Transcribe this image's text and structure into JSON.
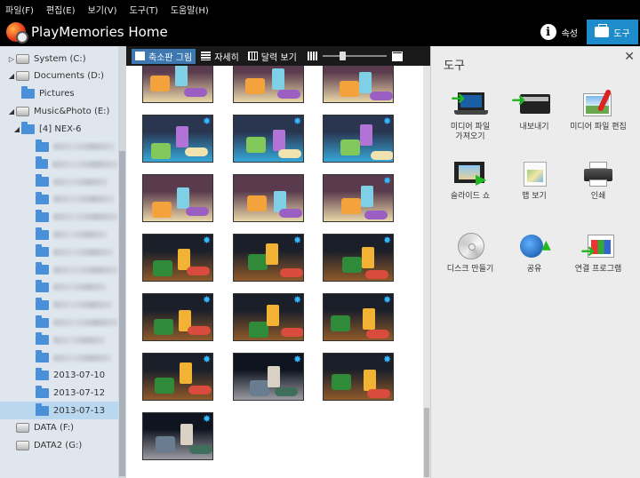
{
  "menu": [
    "파일(F)",
    "편집(E)",
    "보기(V)",
    "도구(T)",
    "도움말(H)"
  ],
  "app_title": "PlayMemories Home",
  "header_buttons": {
    "properties": "속성",
    "tools": "도구"
  },
  "colors": {
    "accent": "#1e8ccb",
    "sidebar_bg": "#dfe6ee",
    "selected_row": "#b9d7ee",
    "folder": "#4a90d9",
    "badge": "#32b8ff"
  },
  "tree": [
    {
      "type": "drive",
      "label": "System (C:)",
      "expanded": false
    },
    {
      "type": "drive",
      "label": "Documents (D:)",
      "expanded": true
    },
    {
      "type": "folder",
      "label": "Pictures"
    },
    {
      "type": "drive",
      "label": "Music&Photo (E:)",
      "expanded": true
    },
    {
      "type": "folder",
      "label": "[4] NEX-6",
      "expanded": true
    },
    {
      "type": "folder",
      "label": "",
      "blurred": true
    },
    {
      "type": "folder",
      "label": "",
      "blurred": true
    },
    {
      "type": "folder",
      "label": "",
      "blurred": true
    },
    {
      "type": "folder",
      "label": "",
      "blurred": true
    },
    {
      "type": "folder",
      "label": "",
      "blurred": true
    },
    {
      "type": "folder",
      "label": "",
      "blurred": true
    },
    {
      "type": "folder",
      "label": "",
      "blurred": true
    },
    {
      "type": "folder",
      "label": "",
      "blurred": true
    },
    {
      "type": "folder",
      "label": "",
      "blurred": true
    },
    {
      "type": "folder",
      "label": "",
      "blurred": true
    },
    {
      "type": "folder",
      "label": "",
      "blurred": true
    },
    {
      "type": "folder",
      "label": "",
      "blurred": true
    },
    {
      "type": "folder",
      "label": "",
      "blurred": true
    },
    {
      "type": "folder",
      "label": "2013-07-10"
    },
    {
      "type": "folder",
      "label": "2013-07-12"
    },
    {
      "type": "folder",
      "label": "2013-07-13",
      "selected": true
    },
    {
      "type": "drive",
      "label": "DATA (F:)"
    },
    {
      "type": "drive",
      "label": "DATA2 (G:)"
    }
  ],
  "view_modes": [
    "축소판 그림",
    "자세히",
    "달력 보기"
  ],
  "active_view": 0,
  "zoom_level": 0.3,
  "thumbnails": [
    {
      "scene": "pool",
      "badge": false
    },
    {
      "scene": "pool",
      "badge": false
    },
    {
      "scene": "pool",
      "badge": false
    },
    {
      "scene": "stepping",
      "badge": true
    },
    {
      "scene": "stepping",
      "badge": true
    },
    {
      "scene": "stepping",
      "badge": true
    },
    {
      "scene": "pool",
      "badge": false
    },
    {
      "scene": "pool",
      "badge": false
    },
    {
      "scene": "pool",
      "badge": true
    },
    {
      "scene": "treehouse",
      "badge": true
    },
    {
      "scene": "treehouse",
      "badge": true
    },
    {
      "scene": "treehouse",
      "badge": true
    },
    {
      "scene": "treehouse",
      "badge": true
    },
    {
      "scene": "treehouse",
      "badge": true
    },
    {
      "scene": "treehouse",
      "badge": true
    },
    {
      "scene": "treehouse",
      "badge": true
    },
    {
      "scene": "figures",
      "badge": true
    },
    {
      "scene": "treehouse",
      "badge": true
    },
    {
      "scene": "figures",
      "badge": true
    }
  ],
  "tools_panel": {
    "title": "도구",
    "items": [
      {
        "label": "미디어 파일\n가져오기",
        "icon": "import-icon"
      },
      {
        "label": "내보내기",
        "icon": "export-icon"
      },
      {
        "label": "미디어 파일 편집",
        "icon": "edit-icon"
      },
      {
        "label": "슬라이드 쇼",
        "icon": "slideshow-icon"
      },
      {
        "label": "맵 보기",
        "icon": "map-icon"
      },
      {
        "label": "인쇄",
        "icon": "printer-icon"
      },
      {
        "label": "디스크 만들기",
        "icon": "disc-icon"
      },
      {
        "label": "공유",
        "icon": "share-icon"
      },
      {
        "label": "연결 프로그램",
        "icon": "open-with-icon"
      }
    ]
  }
}
